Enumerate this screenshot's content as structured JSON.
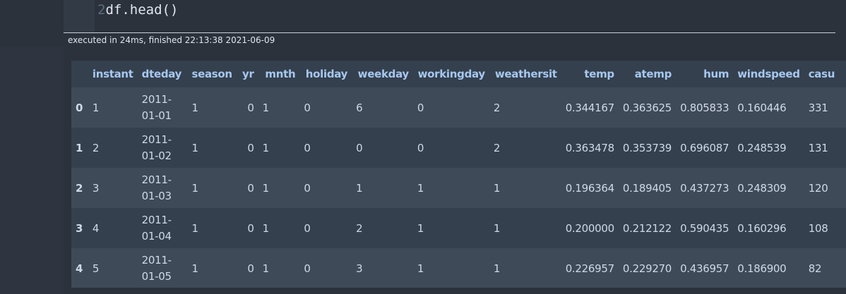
{
  "cell": {
    "line_number": "2",
    "code": "df.head()",
    "execution_info": "executed in 24ms, finished 22:13:38 2021-06-09"
  },
  "dataframe": {
    "columns": [
      "instant",
      "dteday",
      "season",
      "yr",
      "mnth",
      "holiday",
      "weekday",
      "workingday",
      "weathersit",
      "temp",
      "atemp",
      "hum",
      "windspeed",
      "casu"
    ],
    "rows": [
      {
        "index": "0",
        "instant": "1",
        "dteday_a": "2011-",
        "dteday_b": "01-01",
        "season": "1",
        "yr": "0",
        "mnth": "1",
        "holiday": "0",
        "weekday": "6",
        "workingday": "0",
        "weathersit": "2",
        "temp": "0.344167",
        "atemp": "0.363625",
        "hum": "0.805833",
        "windspeed": "0.160446",
        "casual": "331"
      },
      {
        "index": "1",
        "instant": "2",
        "dteday_a": "2011-",
        "dteday_b": "01-02",
        "season": "1",
        "yr": "0",
        "mnth": "1",
        "holiday": "0",
        "weekday": "0",
        "workingday": "0",
        "weathersit": "2",
        "temp": "0.363478",
        "atemp": "0.353739",
        "hum": "0.696087",
        "windspeed": "0.248539",
        "casual": "131"
      },
      {
        "index": "2",
        "instant": "3",
        "dteday_a": "2011-",
        "dteday_b": "01-03",
        "season": "1",
        "yr": "0",
        "mnth": "1",
        "holiday": "0",
        "weekday": "1",
        "workingday": "1",
        "weathersit": "1",
        "temp": "0.196364",
        "atemp": "0.189405",
        "hum": "0.437273",
        "windspeed": "0.248309",
        "casual": "120"
      },
      {
        "index": "3",
        "instant": "4",
        "dteday_a": "2011-",
        "dteday_b": "01-04",
        "season": "1",
        "yr": "0",
        "mnth": "1",
        "holiday": "0",
        "weekday": "2",
        "workingday": "1",
        "weathersit": "1",
        "temp": "0.200000",
        "atemp": "0.212122",
        "hum": "0.590435",
        "windspeed": "0.160296",
        "casual": "108"
      },
      {
        "index": "4",
        "instant": "5",
        "dteday_a": "2011-",
        "dteday_b": "01-05",
        "season": "1",
        "yr": "0",
        "mnth": "1",
        "holiday": "0",
        "weekday": "3",
        "workingday": "1",
        "weathersit": "1",
        "temp": "0.226957",
        "atemp": "0.229270",
        "hum": "0.436957",
        "windspeed": "0.186900",
        "casual": "82"
      }
    ]
  },
  "colors": {
    "background": "#2b323c",
    "header_text": "#a7c7ee",
    "cell_text": "#cfd9e6",
    "row_odd": "#3f4a58",
    "row_even": "#34404e"
  }
}
